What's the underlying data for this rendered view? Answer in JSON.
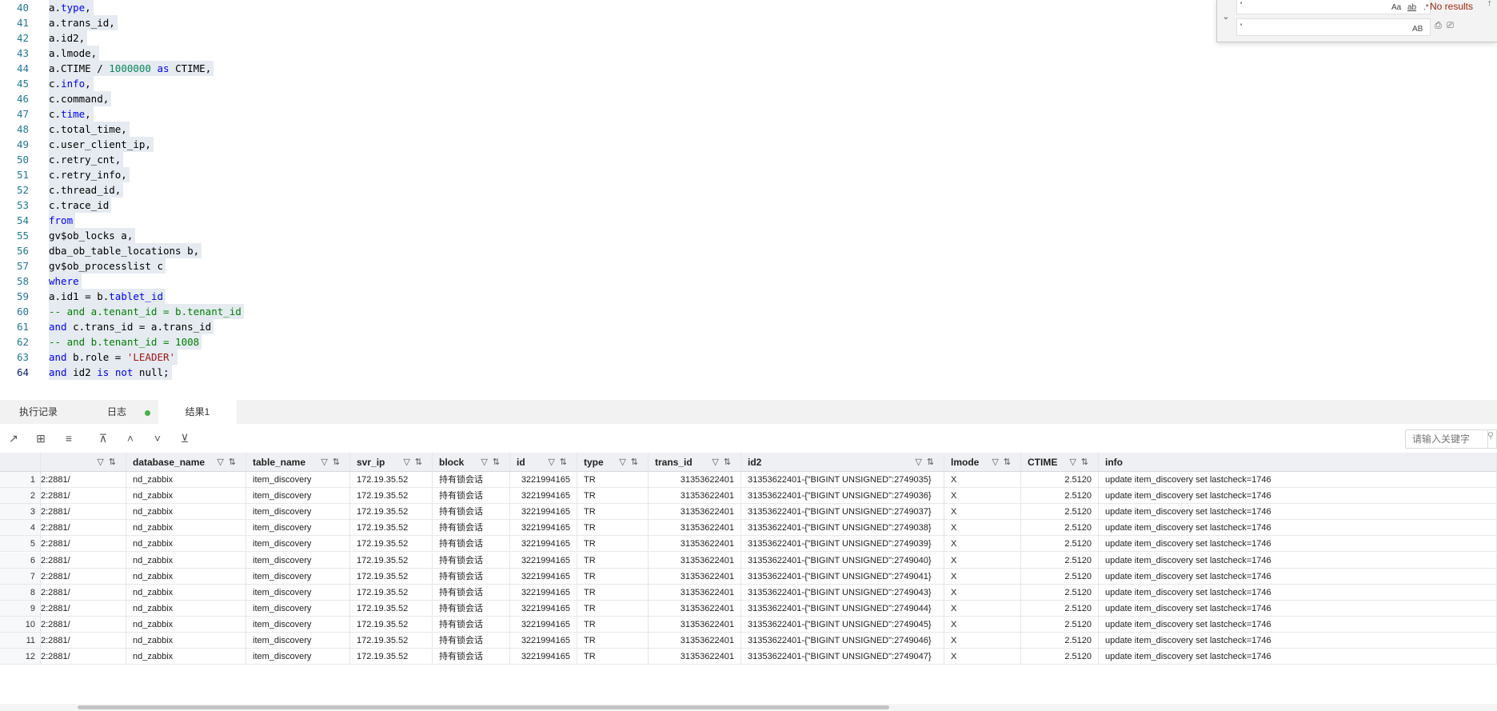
{
  "editor": {
    "lines": [
      {
        "n": "40",
        "t": [
          [
            "a.",
            ""
          ],
          [
            "type",
            "kw"
          ],
          [
            ",",
            ""
          ]
        ]
      },
      {
        "n": "41",
        "t": [
          [
            "a.trans_id,",
            ""
          ]
        ]
      },
      {
        "n": "42",
        "t": [
          [
            "a.id2,",
            ""
          ]
        ]
      },
      {
        "n": "43",
        "t": [
          [
            "a.lmode,",
            ""
          ]
        ]
      },
      {
        "n": "44",
        "t": [
          [
            "a.CTIME / ",
            ""
          ],
          [
            "1000000",
            "num"
          ],
          [
            " ",
            ""
          ],
          [
            "as",
            "kw"
          ],
          [
            " CTIME,",
            ""
          ]
        ]
      },
      {
        "n": "45",
        "t": [
          [
            "c.",
            ""
          ],
          [
            "info",
            "kw"
          ],
          [
            ",",
            ""
          ]
        ]
      },
      {
        "n": "46",
        "t": [
          [
            "c.command,",
            ""
          ]
        ]
      },
      {
        "n": "47",
        "t": [
          [
            "c.",
            ""
          ],
          [
            "time",
            "kw"
          ],
          [
            ",",
            ""
          ]
        ]
      },
      {
        "n": "48",
        "t": [
          [
            "c.total_time,",
            ""
          ]
        ]
      },
      {
        "n": "49",
        "t": [
          [
            "c.user_client_ip,",
            ""
          ]
        ]
      },
      {
        "n": "50",
        "t": [
          [
            "c.retry_cnt,",
            ""
          ]
        ]
      },
      {
        "n": "51",
        "t": [
          [
            "c.retry_info,",
            ""
          ]
        ]
      },
      {
        "n": "52",
        "t": [
          [
            "c.thread_id,",
            ""
          ]
        ]
      },
      {
        "n": "53",
        "t": [
          [
            "c.trace_id",
            ""
          ]
        ]
      },
      {
        "n": "54",
        "t": [
          [
            "from",
            "kw"
          ]
        ]
      },
      {
        "n": "55",
        "t": [
          [
            "gv$ob_locks a,",
            ""
          ]
        ]
      },
      {
        "n": "56",
        "t": [
          [
            "dba_ob_table_locations b,",
            ""
          ]
        ]
      },
      {
        "n": "57",
        "t": [
          [
            "gv$ob_processlist c",
            ""
          ]
        ]
      },
      {
        "n": "58",
        "t": [
          [
            "where",
            "kw"
          ]
        ]
      },
      {
        "n": "59",
        "t": [
          [
            "a.id1 = b.",
            ""
          ],
          [
            "tablet_id",
            "kw"
          ]
        ]
      },
      {
        "n": "60",
        "t": [
          [
            "-- and a.tenant_id = b.tenant_id",
            "cmt"
          ]
        ]
      },
      {
        "n": "61",
        "t": [
          [
            "and",
            "kw"
          ],
          [
            " c.trans_id = a.trans_id",
            ""
          ]
        ]
      },
      {
        "n": "62",
        "t": [
          [
            "-- and b.tenant_id = 1008",
            "cmt"
          ]
        ]
      },
      {
        "n": "63",
        "t": [
          [
            "and",
            "kw"
          ],
          [
            " b.role = ",
            ""
          ],
          [
            "'LEADER'",
            "str"
          ]
        ]
      },
      {
        "n": "64",
        "t": [
          [
            "and",
            "kw"
          ],
          [
            " id2 ",
            ""
          ],
          [
            "is",
            "kw"
          ],
          [
            " ",
            ""
          ],
          [
            "not",
            "kw"
          ],
          [
            " null;",
            ""
          ]
        ]
      }
    ]
  },
  "find_widget": {
    "find_value": "'",
    "replace_value": "'",
    "opt_case": "Aa",
    "opt_word": "ab",
    "opt_regex": ".*",
    "opt_preserve": "AB",
    "results": "No results"
  },
  "tabs": [
    {
      "label": "执行记录"
    },
    {
      "label": "日志"
    },
    {
      "label": "结果1"
    }
  ],
  "search": {
    "placeholder": "请输入关键字"
  },
  "grid": {
    "columns": [
      "",
      "database_name",
      "table_name",
      "svr_ip",
      "block",
      "id",
      "type",
      "trans_id",
      "id2",
      "lmode",
      "CTIME",
      "info"
    ],
    "rows": [
      [
        "1",
        "2:2881/",
        "nd_zabbix",
        "item_discovery",
        "172.19.35.52",
        "持有锁会话",
        "3221994165",
        "TR",
        "31353622401",
        "31353622401-{\"BIGINT UNSIGNED\":2749035}",
        "X",
        "2.5120",
        "update item_discovery set lastcheck=1746"
      ],
      [
        "2",
        "2:2881/",
        "nd_zabbix",
        "item_discovery",
        "172.19.35.52",
        "持有锁会话",
        "3221994165",
        "TR",
        "31353622401",
        "31353622401-{\"BIGINT UNSIGNED\":2749036}",
        "X",
        "2.5120",
        "update item_discovery set lastcheck=1746"
      ],
      [
        "3",
        "2:2881/",
        "nd_zabbix",
        "item_discovery",
        "172.19.35.52",
        "持有锁会话",
        "3221994165",
        "TR",
        "31353622401",
        "31353622401-{\"BIGINT UNSIGNED\":2749037}",
        "X",
        "2.5120",
        "update item_discovery set lastcheck=1746"
      ],
      [
        "4",
        "2:2881/",
        "nd_zabbix",
        "item_discovery",
        "172.19.35.52",
        "持有锁会话",
        "3221994165",
        "TR",
        "31353622401",
        "31353622401-{\"BIGINT UNSIGNED\":2749038}",
        "X",
        "2.5120",
        "update item_discovery set lastcheck=1746"
      ],
      [
        "5",
        "2:2881/",
        "nd_zabbix",
        "item_discovery",
        "172.19.35.52",
        "持有锁会话",
        "3221994165",
        "TR",
        "31353622401",
        "31353622401-{\"BIGINT UNSIGNED\":2749039}",
        "X",
        "2.5120",
        "update item_discovery set lastcheck=1746"
      ],
      [
        "6",
        "2:2881/",
        "nd_zabbix",
        "item_discovery",
        "172.19.35.52",
        "持有锁会话",
        "3221994165",
        "TR",
        "31353622401",
        "31353622401-{\"BIGINT UNSIGNED\":2749040}",
        "X",
        "2.5120",
        "update item_discovery set lastcheck=1746"
      ],
      [
        "7",
        "2:2881/",
        "nd_zabbix",
        "item_discovery",
        "172.19.35.52",
        "持有锁会话",
        "3221994165",
        "TR",
        "31353622401",
        "31353622401-{\"BIGINT UNSIGNED\":2749041}",
        "X",
        "2.5120",
        "update item_discovery set lastcheck=1746"
      ],
      [
        "8",
        "2:2881/",
        "nd_zabbix",
        "item_discovery",
        "172.19.35.52",
        "持有锁会话",
        "3221994165",
        "TR",
        "31353622401",
        "31353622401-{\"BIGINT UNSIGNED\":2749043}",
        "X",
        "2.5120",
        "update item_discovery set lastcheck=1746"
      ],
      [
        "9",
        "2:2881/",
        "nd_zabbix",
        "item_discovery",
        "172.19.35.52",
        "持有锁会话",
        "3221994165",
        "TR",
        "31353622401",
        "31353622401-{\"BIGINT UNSIGNED\":2749044}",
        "X",
        "2.5120",
        "update item_discovery set lastcheck=1746"
      ],
      [
        "10",
        "2:2881/",
        "nd_zabbix",
        "item_discovery",
        "172.19.35.52",
        "持有锁会话",
        "3221994165",
        "TR",
        "31353622401",
        "31353622401-{\"BIGINT UNSIGNED\":2749045}",
        "X",
        "2.5120",
        "update item_discovery set lastcheck=1746"
      ],
      [
        "11",
        "2:2881/",
        "nd_zabbix",
        "item_discovery",
        "172.19.35.52",
        "持有锁会话",
        "3221994165",
        "TR",
        "31353622401",
        "31353622401-{\"BIGINT UNSIGNED\":2749046}",
        "X",
        "2.5120",
        "update item_discovery set lastcheck=1746"
      ],
      [
        "12",
        "2:2881/",
        "nd_zabbix",
        "item_discovery",
        "172.19.35.52",
        "持有锁会话",
        "3221994165",
        "TR",
        "31353622401",
        "31353622401-{\"BIGINT UNSIGNED\":2749047}",
        "X",
        "2.5120",
        "update item_discovery set lastcheck=1746"
      ]
    ]
  }
}
